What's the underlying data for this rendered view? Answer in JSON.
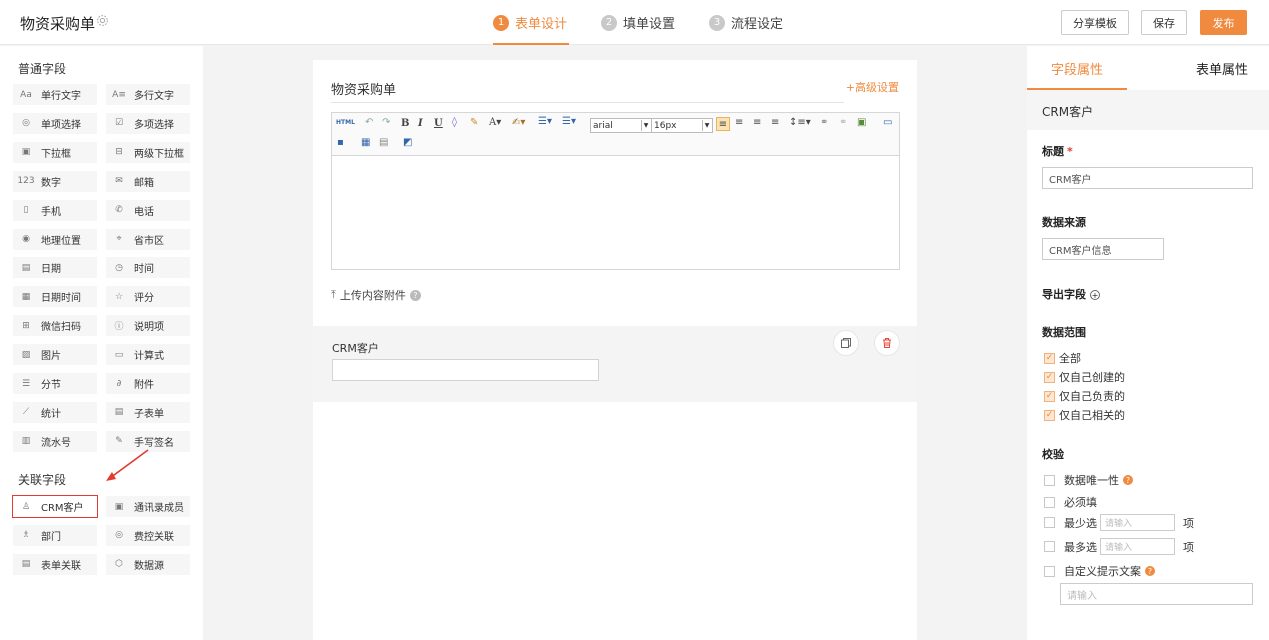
{
  "header": {
    "app_title": "物资采购单",
    "steps": [
      {
        "num": "1",
        "label": "表单设计"
      },
      {
        "num": "2",
        "label": "填单设置"
      },
      {
        "num": "3",
        "label": "流程设定"
      }
    ],
    "share_label": "分享模板",
    "save_label": "保存",
    "publish_label": "发布"
  },
  "left": {
    "common_title": "普通字段",
    "common_fields": [
      {
        "icon": "text-icon",
        "label": "单行文字"
      },
      {
        "icon": "multiline-icon",
        "label": "多行文字"
      },
      {
        "icon": "radio-icon",
        "label": "单项选择"
      },
      {
        "icon": "checkbox-icon",
        "label": "多项选择"
      },
      {
        "icon": "dropdown-icon",
        "label": "下拉框"
      },
      {
        "icon": "cascade-dropdown-icon",
        "label": "两级下拉框"
      },
      {
        "icon": "number-icon",
        "label": "数字"
      },
      {
        "icon": "mail-icon",
        "label": "邮箱"
      },
      {
        "icon": "mobile-icon",
        "label": "手机"
      },
      {
        "icon": "phone-icon",
        "label": "电话"
      },
      {
        "icon": "location-icon",
        "label": "地理位置"
      },
      {
        "icon": "region-icon",
        "label": "省市区"
      },
      {
        "icon": "calendar-icon",
        "label": "日期"
      },
      {
        "icon": "clock-icon",
        "label": "时间"
      },
      {
        "icon": "datetime-icon",
        "label": "日期时间"
      },
      {
        "icon": "star-icon",
        "label": "评分"
      },
      {
        "icon": "qr-scan-icon",
        "label": "微信扫码"
      },
      {
        "icon": "info-icon",
        "label": "说明项"
      },
      {
        "icon": "image-icon",
        "label": "图片"
      },
      {
        "icon": "calculator-icon",
        "label": "计算式"
      },
      {
        "icon": "section-icon",
        "label": "分节"
      },
      {
        "icon": "attachment-icon",
        "label": "附件"
      },
      {
        "icon": "chart-icon",
        "label": "统计"
      },
      {
        "icon": "subform-icon",
        "label": "子表单"
      },
      {
        "icon": "serial-icon",
        "label": "流水号"
      },
      {
        "icon": "signature-icon",
        "label": "手写签名"
      }
    ],
    "related_title": "关联字段",
    "related_fields": [
      {
        "icon": "user-icon",
        "label": "CRM客户"
      },
      {
        "icon": "contacts-icon",
        "label": "通讯录成员"
      },
      {
        "icon": "department-icon",
        "label": "部门"
      },
      {
        "icon": "expense-icon",
        "label": "费控关联"
      },
      {
        "icon": "form-link-icon",
        "label": "表单关联"
      },
      {
        "icon": "datasource-icon",
        "label": "数据源"
      }
    ]
  },
  "canvas": {
    "form_title": "物资采购单",
    "advanced_label": "+高级设置",
    "font_family": "arial",
    "font_size": "16px",
    "upload_label": "上传内容附件",
    "crm_label": "CRM客户"
  },
  "right": {
    "tabs": [
      "字段属性",
      "表单属性"
    ],
    "field_name": "CRM客户",
    "title_label": "标题",
    "title_value": "CRM客户",
    "source_label": "数据来源",
    "source_value": "CRM客户信息",
    "export_label": "导出字段",
    "scope_label": "数据范围",
    "scope_options": [
      "全部",
      "仅自己创建的",
      "仅自己负责的",
      "仅自己相关的"
    ],
    "validate_label": "校验",
    "unique_label": "数据唯一性",
    "required_label": "必须填",
    "min_label": "最少选",
    "max_label": "最多选",
    "item_unit": "项",
    "input_placeholder": "请输入",
    "custom_tip_label": "自定义提示文案"
  },
  "colors": {
    "accent": "#f08a3e",
    "highlight_red": "#e23b30"
  }
}
